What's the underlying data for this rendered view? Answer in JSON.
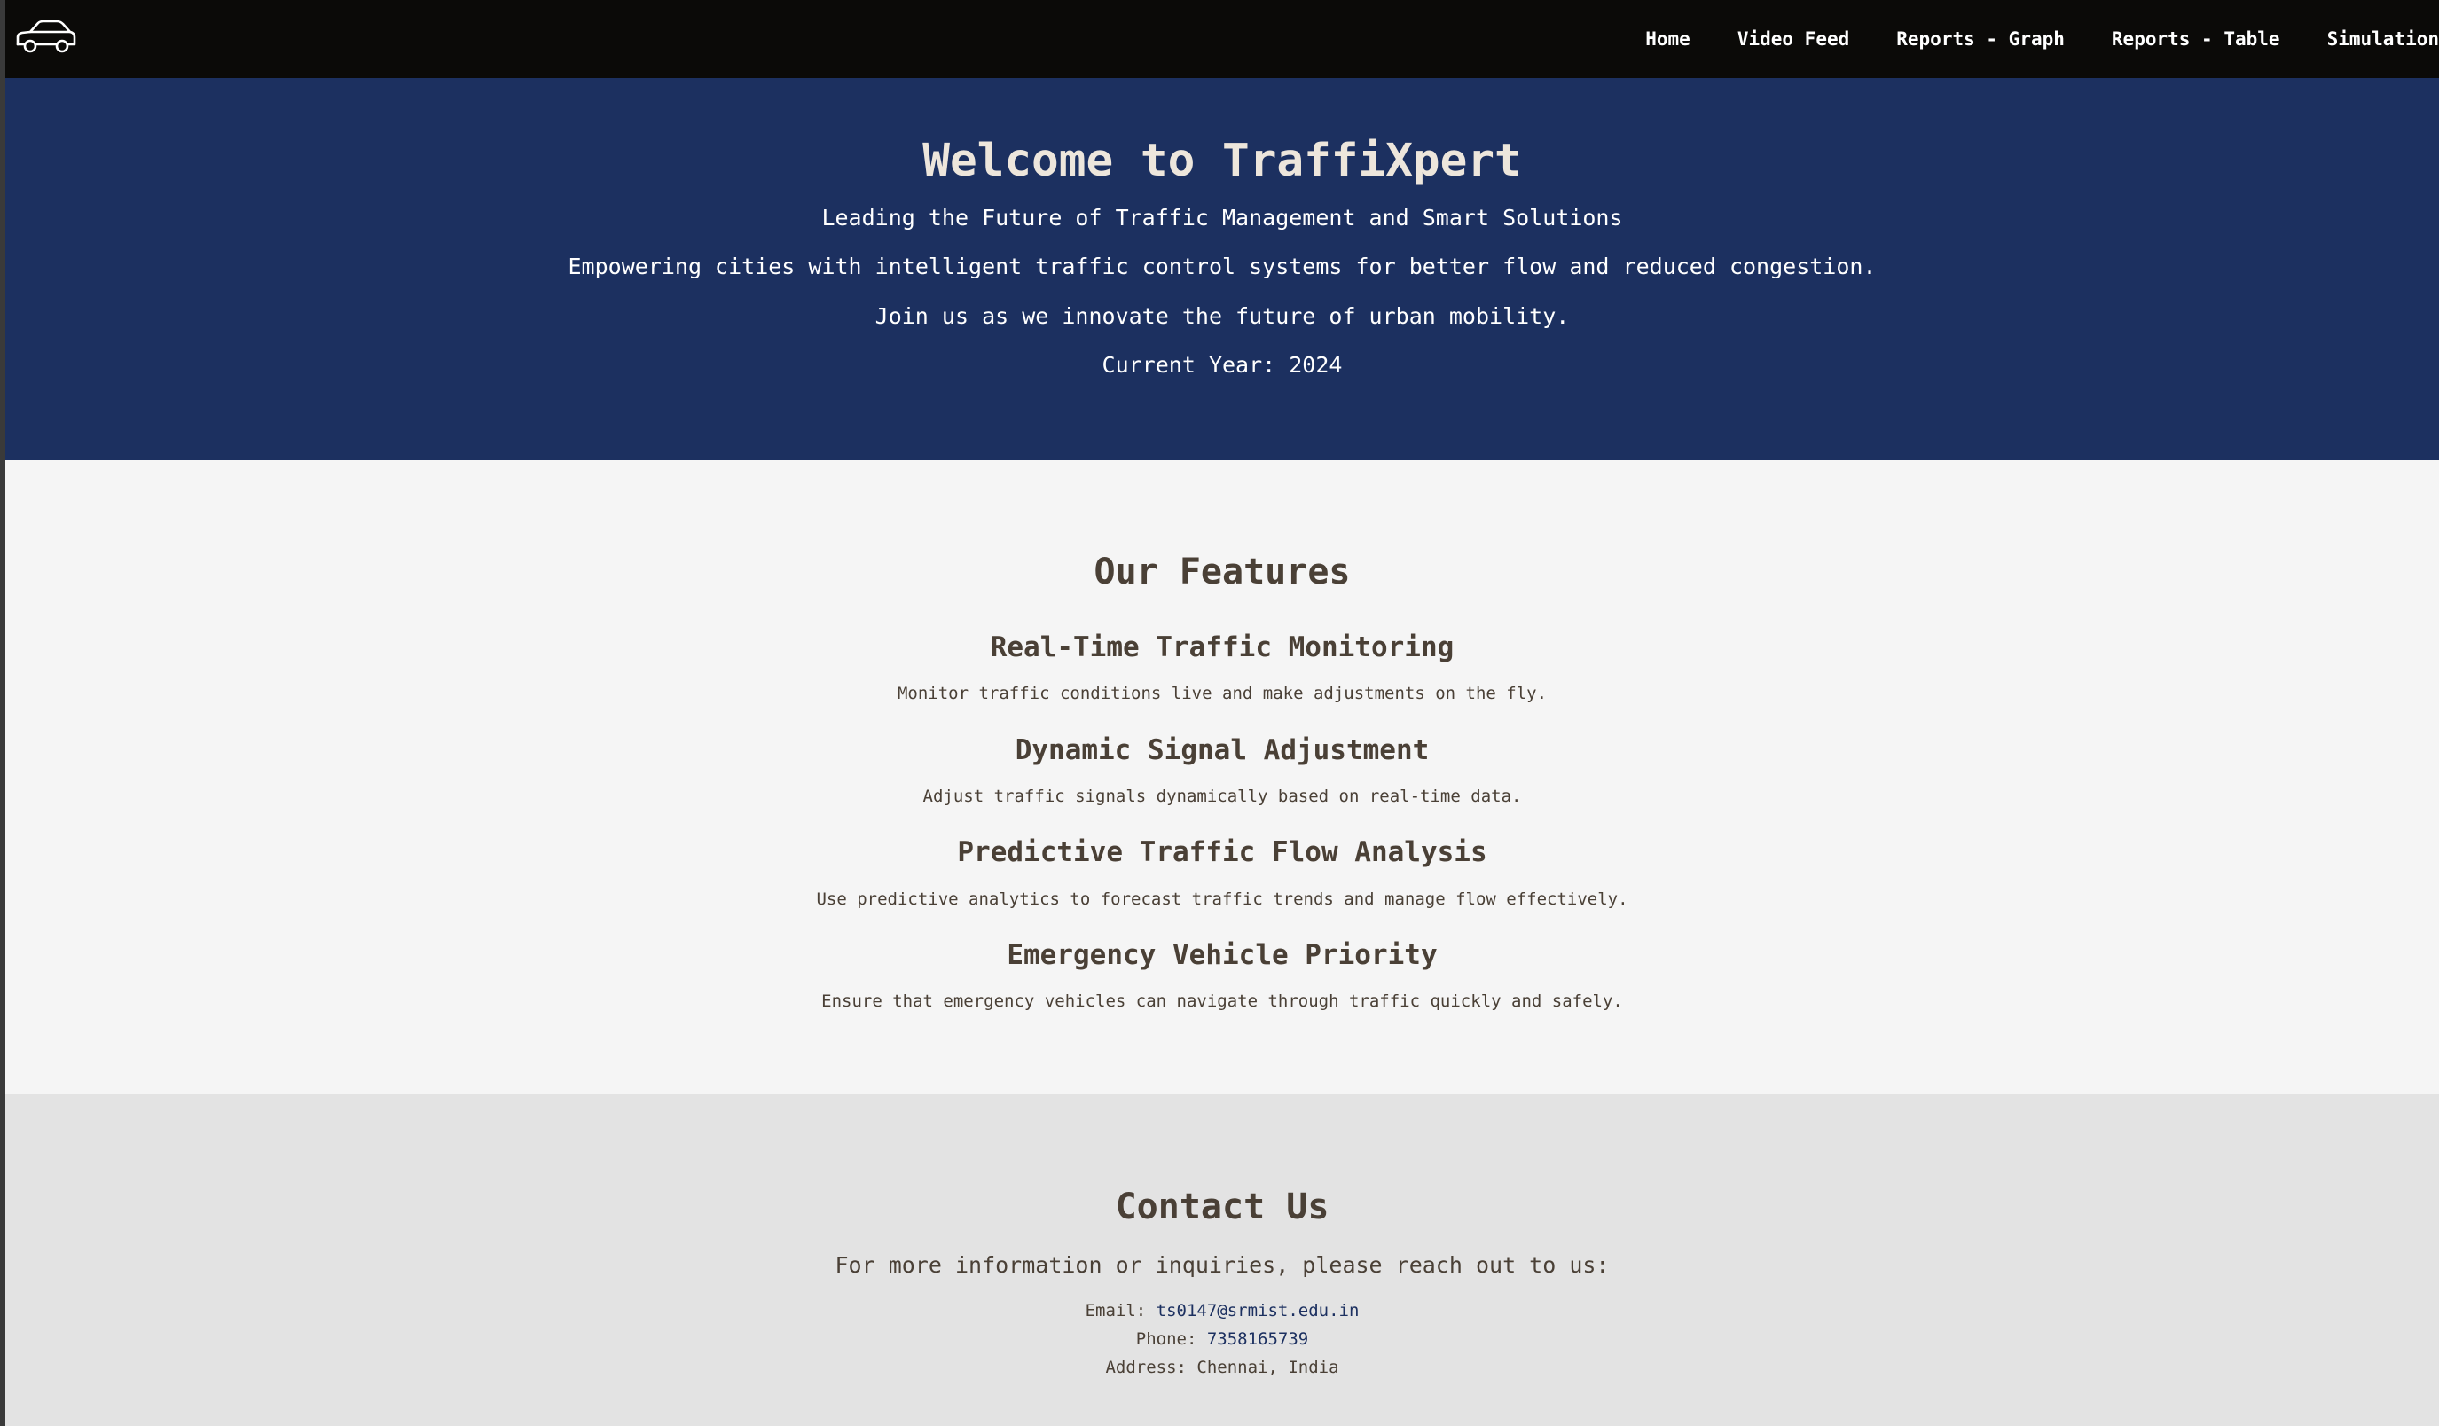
{
  "nav": {
    "logo_icon": "car-icon",
    "items": [
      {
        "label": "Home"
      },
      {
        "label": "Video Feed"
      },
      {
        "label": "Reports - Graph"
      },
      {
        "label": "Reports - Table"
      },
      {
        "label": "Simulation"
      }
    ]
  },
  "hero": {
    "title": "Welcome to TraffiXpert",
    "subtitle": "Leading the Future of Traffic Management and Smart Solutions",
    "line1": "Empowering cities with intelligent traffic control systems for better flow and reduced congestion.",
    "line2": "Join us as we innovate the future of urban mobility.",
    "year_line": "Current Year: 2024"
  },
  "features": {
    "title": "Our Features",
    "items": [
      {
        "title": "Real-Time Traffic Monitoring",
        "desc": "Monitor traffic conditions live and make adjustments on the fly."
      },
      {
        "title": "Dynamic Signal Adjustment",
        "desc": "Adjust traffic signals dynamically based on real-time data."
      },
      {
        "title": "Predictive Traffic Flow Analysis",
        "desc": "Use predictive analytics to forecast traffic trends and manage flow effectively."
      },
      {
        "title": "Emergency Vehicle Priority",
        "desc": "Ensure that emergency vehicles can navigate through traffic quickly and safely."
      }
    ]
  },
  "contact": {
    "title": "Contact Us",
    "intro": "For more information or inquiries, please reach out to us:",
    "email_label": "Email: ",
    "email": "ts0147@srmist.edu.in",
    "phone_label": "Phone: ",
    "phone": "7358165739",
    "address_label": "Address: ",
    "address": "Chennai, India"
  },
  "colors": {
    "navbar": "#0b0a08",
    "hero": "#1c3060",
    "features_bg": "#f5f5f5",
    "contact_bg": "#e3e3e3",
    "text": "#4a4036"
  }
}
